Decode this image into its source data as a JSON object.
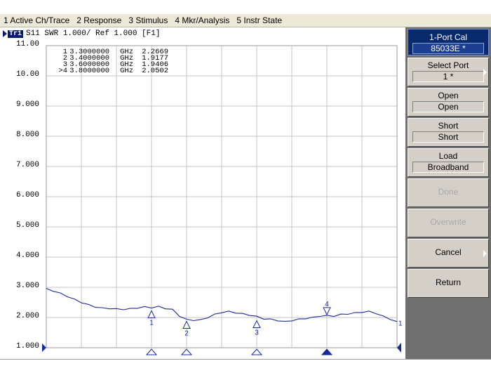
{
  "menubar": {
    "items": [
      "1 Active Ch/Trace",
      "2 Response",
      "3 Stimulus",
      "4 Mkr/Analysis",
      "5 Instr State"
    ]
  },
  "trace_label": {
    "badge": "Tr1",
    "text": "S11  SWR 1.000/ Ref 1.000 [F1]"
  },
  "markers_table": [
    {
      "id": "1",
      "freq": "3.3000000",
      "unit": "GHz",
      "value": "2.2669"
    },
    {
      "id": "2",
      "freq": "3.4000000",
      "unit": "GHz",
      "value": "1.9177"
    },
    {
      "id": ">4",
      "freq": "3.8000000",
      "unit": "GHz",
      "value": "2.0502"
    },
    {
      "id": "3",
      "freq": "3.6000000",
      "unit": "GHz",
      "value": "1.9406"
    }
  ],
  "chart_data": {
    "type": "line",
    "ylabel": "SWR",
    "ylim": [
      1,
      11
    ],
    "y_ticks": [
      "11.00",
      "10.00",
      "9.000",
      "8.000",
      "7.000",
      "6.000",
      "5.000",
      "4.000",
      "3.000",
      "2.000",
      "1.000"
    ],
    "reference_value": 1.0,
    "grid": true,
    "series": [
      {
        "x": [
          0,
          0.2,
          0.4,
          0.6,
          0.8,
          1,
          1.2,
          1.4,
          1.6,
          1.8,
          2,
          2.2,
          2.4,
          2.6,
          2.8,
          3,
          3.2,
          3.4,
          3.6,
          3.8,
          4,
          4.2,
          4.4,
          4.6,
          4.8,
          5,
          5.2,
          5.4,
          5.6,
          5.8,
          6,
          6.2,
          6.4,
          6.6,
          6.8,
          7,
          7.2,
          7.4,
          7.6,
          7.8,
          8,
          8.2,
          8.4,
          8.6,
          8.8,
          9,
          9.2,
          9.4,
          9.6,
          9.8,
          10
        ],
        "values": [
          2.95,
          2.88,
          2.8,
          2.7,
          2.6,
          2.5,
          2.42,
          2.35,
          2.31,
          2.3,
          2.28,
          2.27,
          2.29,
          2.32,
          2.35,
          2.33,
          2.36,
          2.3,
          2.26,
          2.05,
          1.93,
          1.91,
          1.92,
          2.0,
          2.1,
          2.17,
          2.2,
          2.16,
          2.12,
          2.08,
          2.03,
          1.96,
          1.94,
          1.9,
          1.86,
          1.9,
          1.94,
          1.97,
          2.0,
          2.05,
          2.06,
          2.05,
          2.1,
          2.12,
          2.15,
          2.18,
          2.2,
          2.14,
          2.04,
          1.95,
          1.85
        ]
      }
    ],
    "markers": [
      {
        "id": "1",
        "x": 3.0,
        "y": 2.2669
      },
      {
        "id": "2",
        "x": 4.0,
        "y": 1.9177
      },
      {
        "id": "3",
        "x": 6.0,
        "y": 1.9406
      },
      {
        "id": "4",
        "x": 8.0,
        "y": 2.0502,
        "active": true
      }
    ],
    "end_label": "1"
  },
  "softkeys": {
    "title": {
      "label": "1-Port Cal",
      "value": "85033E *"
    },
    "items": [
      {
        "label": "Select Port",
        "value": "1 *",
        "arrow": true,
        "enabled": true
      },
      {
        "label": "Open",
        "value": "Open",
        "arrow": false,
        "enabled": true
      },
      {
        "label": "Short",
        "value": "Short",
        "arrow": false,
        "enabled": true
      },
      {
        "label": "Load",
        "value": "Broadband",
        "arrow": false,
        "enabled": true
      },
      {
        "label": "Done",
        "value": null,
        "arrow": false,
        "enabled": false
      },
      {
        "label": "Overwrite",
        "value": null,
        "arrow": false,
        "enabled": false
      },
      {
        "label": "Cancel",
        "value": null,
        "arrow": true,
        "enabled": true
      },
      {
        "label": "Return",
        "value": null,
        "arrow": false,
        "enabled": true
      }
    ]
  },
  "colors": {
    "trace": "#1a2a9a",
    "grid": "#c6c6c6",
    "softkey_title_bg": "#0a2a6e",
    "softkey_panel_bg": "#6f6f6f"
  }
}
